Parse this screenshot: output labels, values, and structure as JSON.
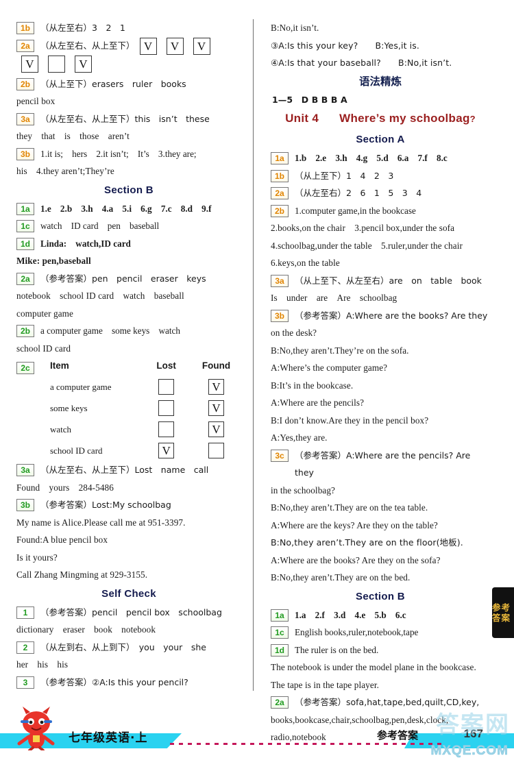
{
  "left_column": {
    "entries": [
      {
        "tag": "1b",
        "tag_color": "orange",
        "lines": [
          "（从左至右）3　2　1"
        ]
      },
      {
        "tag": "2a",
        "tag_color": "orange",
        "lines": [
          "（从左至右、从上至下）"
        ],
        "checks_row1": [
          "V",
          "V",
          "V"
        ],
        "checks_row2": [
          "V",
          "",
          "V"
        ]
      },
      {
        "tag": "2b",
        "tag_color": "orange",
        "lines": [
          "（从上至下）erasers　ruler　books",
          "pencil box"
        ]
      },
      {
        "tag": "3a",
        "tag_color": "orange",
        "lines": [
          "（从左至右、从上至下）this　isn’t　these",
          "they　that　is　those　aren’t"
        ]
      },
      {
        "tag": "3b",
        "tag_color": "orange",
        "lines": [
          "1.it is;　hers　2.it isn’t;　It’s　3.they are;",
          "his　4.they aren’t;They’re"
        ]
      }
    ],
    "section_b_heading": "Section B",
    "section_b_entries": [
      {
        "tag": "1a",
        "tag_color": "green",
        "lines": [
          "1.e　2.b　3.h　4.a　5.i　6.g　7.c　8.d　9.f"
        ]
      },
      {
        "tag": "1c",
        "tag_color": "green",
        "lines": [
          "watch　ID card　pen　baseball"
        ]
      },
      {
        "tag": "1d",
        "tag_color": "green",
        "lines": [
          "Linda:　watch,ID card",
          "Mike: pen,baseball"
        ]
      },
      {
        "tag": "2a",
        "tag_color": "green",
        "lines": [
          "（参考答案）pen　pencil　eraser　keys",
          "notebook　school ID card　watch　baseball",
          "computer game"
        ]
      },
      {
        "tag": "2b",
        "tag_color": "green",
        "lines": [
          "a computer game　some keys　watch",
          "school ID card"
        ]
      }
    ],
    "table_2c": {
      "tag": "2c",
      "tag_color": "green",
      "headers": [
        "Item",
        "Lost",
        "Found"
      ],
      "rows": [
        {
          "item": "a computer game",
          "lost": "",
          "found": "V"
        },
        {
          "item": "some keys",
          "lost": "",
          "found": "V"
        },
        {
          "item": "watch",
          "lost": "",
          "found": "V"
        },
        {
          "item": "school ID card",
          "lost": "V",
          "found": ""
        }
      ]
    },
    "after_table_entries": [
      {
        "tag": "3a",
        "tag_color": "green",
        "lines": [
          "（从左至右、从上至下）Lost　name　call",
          "Found　yours　284-5486"
        ]
      },
      {
        "tag": "3b",
        "tag_color": "green",
        "lines": [
          "（参考答案）Lost:My schoolbag",
          "My name is Alice.Please call me at 951-3397.",
          "Found:A blue pencil box",
          "Is it yours?",
          "Call Zhang Mingming at 929-3155."
        ]
      }
    ],
    "self_check_heading": "Self Check",
    "self_check_entries": [
      {
        "tag": "1",
        "tag_color": "plain",
        "lines": [
          "（参考答案）pencil　pencil box　schoolbag",
          "dictionary　eraser　book　notebook"
        ]
      },
      {
        "tag": "2",
        "tag_color": "plain",
        "lines": [
          "（从左到右、从上到下）　you　your　she",
          "her　his　his"
        ]
      },
      {
        "tag": "3",
        "tag_color": "plain",
        "lines": [
          "（参考答案）②A:Is this your pencil?"
        ]
      }
    ]
  },
  "right_column": {
    "top_lines": [
      "B:No,it isn’t.",
      "③A:Is this your key?　　B:Yes,it is.",
      "④A:Is that your baseball?　　B:No,it isn’t."
    ],
    "grammar_heading": "语法精炼",
    "grammar_answers": "1—5　D B B B A",
    "unit_heading": {
      "unit": "Unit 4",
      "title": "Where’s my schoolbag",
      "question_mark": "?"
    },
    "section_a_heading": "Section A",
    "section_a_entries": [
      {
        "tag": "1a",
        "tag_color": "orange",
        "lines": [
          "1.b　2.e　3.h　4.g　5.d　6.a　7.f　8.c"
        ]
      },
      {
        "tag": "1b",
        "tag_color": "orange",
        "lines": [
          "（从上至下）1　4　2　3"
        ]
      },
      {
        "tag": "2a",
        "tag_color": "orange",
        "lines": [
          "（从左至右）2　6　1　5　3　4"
        ]
      },
      {
        "tag": "2b",
        "tag_color": "orange",
        "lines": [
          "1.computer game,in the bookcase",
          "2.books,on the chair　3.pencil box,under the sofa",
          "4.schoolbag,under the table　5.ruler,under the chair",
          "6.keys,on the table"
        ]
      },
      {
        "tag": "3a",
        "tag_color": "orange",
        "lines": [
          "（从上至下、从左至右）are　on　table　book",
          "Is　under　are　Are　schoolbag"
        ]
      },
      {
        "tag": "3b",
        "tag_color": "orange",
        "lines": [
          "（参考答案）A:Where are the books? Are they",
          "on the desk?",
          "B:No,they aren’t.They’re on the sofa.",
          "A:Where’s the computer game?",
          "B:It’s in the bookcase.",
          "A:Where are the pencils?",
          "B:I don’t know.Are they in the pencil box?",
          "A:Yes,they are."
        ]
      },
      {
        "tag": "3c",
        "tag_color": "orange",
        "lines": [
          "（参考答案）A:Where are the pencils? Are they",
          "in the schoolbag?",
          "B:No,they aren’t.They are on the tea table.",
          "A:Where are the keys? Are they on the table?",
          "B:No,they aren’t.They are on the floor(地板).",
          "A:Where are the books? Are they on the sofa?",
          "B:No,they aren’t.They are on the bed."
        ]
      }
    ],
    "section_b_heading": "Section B",
    "section_b_entries": [
      {
        "tag": "1a",
        "tag_color": "green",
        "lines": [
          "1.a　2.f　3.d　4.e　5.b　6.c"
        ]
      },
      {
        "tag": "1c",
        "tag_color": "green",
        "lines": [
          "English books,ruler,notebook,tape"
        ]
      },
      {
        "tag": "1d",
        "tag_color": "green",
        "lines": [
          "The ruler is on the bed.",
          "The notebook is under the model plane in the bookcase.",
          "The tape is in the tape player."
        ]
      },
      {
        "tag": "2a",
        "tag_color": "green",
        "lines": [
          "（参考答案）sofa,hat,tape,bed,quilt,CD,key,",
          "books,bookcase,chair,schoolbag,pen,desk,clock,",
          "radio,notebook"
        ]
      }
    ]
  },
  "side_tab": {
    "label": "参考答案"
  },
  "footer": {
    "grade_label": "七年级英语·上",
    "answer_label": "参考答案",
    "page_number": "167",
    "watermark_text": "MXQE.COM",
    "watermark_cn": "答案网",
    "ribbon_color": "#2ad2f0",
    "dots_color": "#c4185a"
  },
  "colors": {
    "tag_orange": "#e08400",
    "tag_green": "#1f9a1f",
    "heading_navy": "#131a4d",
    "unit_red": "#9b2020"
  }
}
